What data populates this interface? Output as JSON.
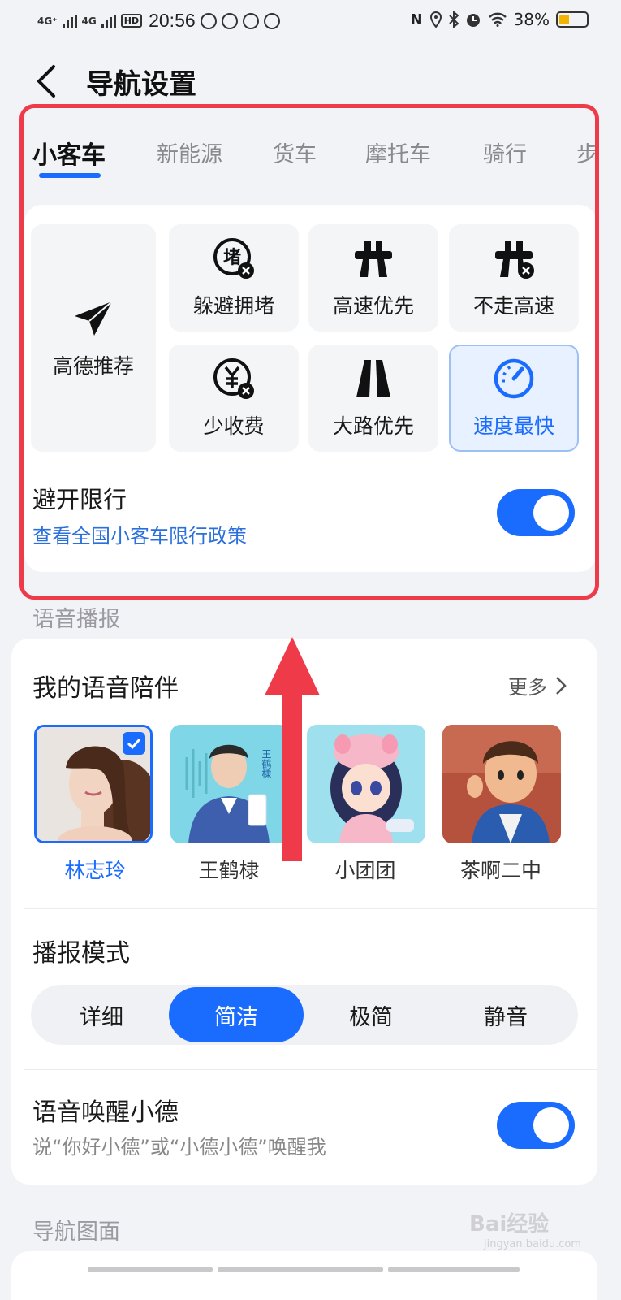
{
  "status_bar": {
    "signal_1": "4G⁺",
    "signal_2": "4G",
    "hd": "HD",
    "time": "20:56",
    "battery_percent": "38%",
    "battery_level": 0.38,
    "nfc": "N"
  },
  "header": {
    "title": "导航设置"
  },
  "vehicle_tabs": [
    "小客车",
    "新能源",
    "货车",
    "摩托车",
    "骑行",
    "步"
  ],
  "route_options": {
    "recommend": "高德推荐",
    "avoid_jam": "躲避拥堵",
    "highway_first": "高速优先",
    "no_highway": "不走高速",
    "less_toll": "少收费",
    "main_road": "大路优先",
    "fastest": "速度最快"
  },
  "restriction": {
    "title": "避开限行",
    "link": "查看全国小客车限行政策",
    "enabled": true
  },
  "section_voice": "语音播报",
  "voice": {
    "title": "我的语音陪伴",
    "more": "更多",
    "voices": [
      "林志玲",
      "王鹤棣",
      "小团团",
      "茶啊二中"
    ],
    "avatar2_text": "王鹤棣"
  },
  "broadcast": {
    "title": "播报模式",
    "modes": [
      "详细",
      "简洁",
      "极简",
      "静音"
    ],
    "selected": "简洁"
  },
  "wake": {
    "title": "语音唤醒小德",
    "subtitle": "说“你好小德”或“小德小德”唤醒我",
    "enabled": true
  },
  "section_nav": "导航图面",
  "watermark": {
    "main": "Bai经验",
    "sub": "jingyan.baidu.com"
  },
  "colors": {
    "accent": "#1a6cff",
    "highlight": "#ef3a4a",
    "link": "#2a6fdb"
  }
}
